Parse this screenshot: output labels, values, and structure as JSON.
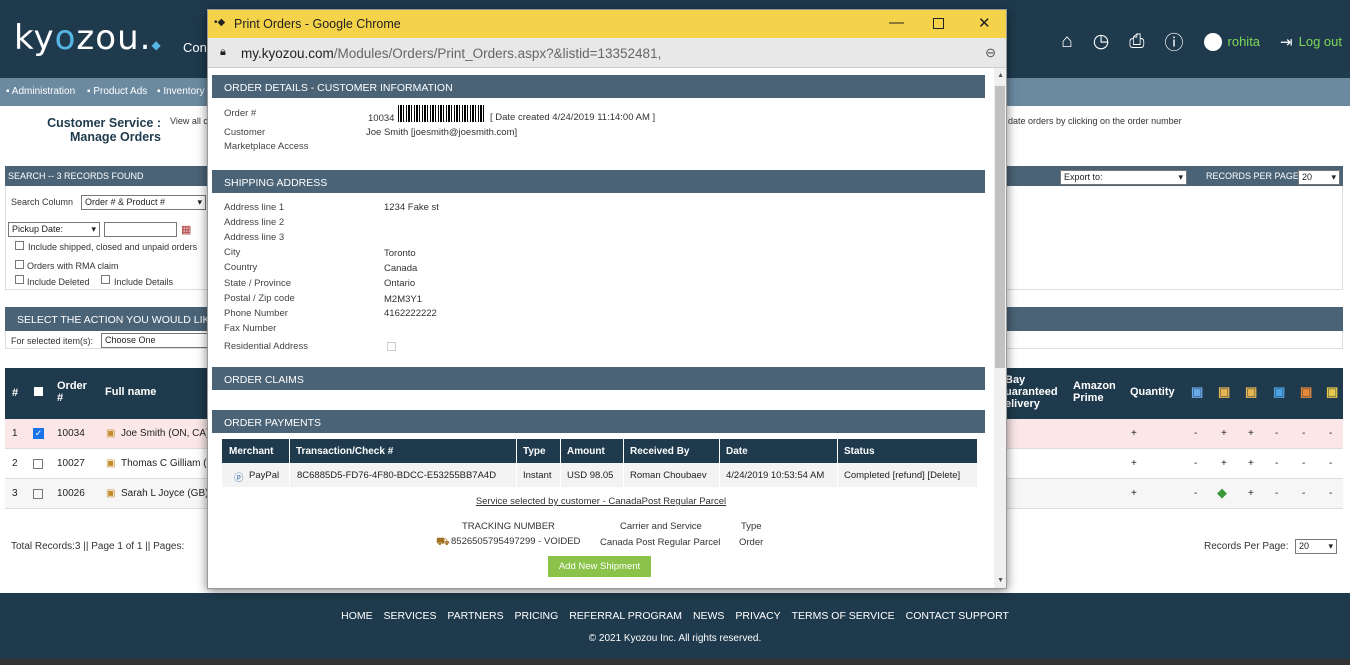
{
  "header": {
    "logo": "kyozou",
    "logo_sub": "Con",
    "user": "rohita",
    "logout": "Log out"
  },
  "nav": [
    "Administration",
    "Product Ads",
    "Inventory"
  ],
  "page": {
    "title": "Customer Service : Manage Orders",
    "desc_left": "View all c",
    "desc_right": "date orders by clicking on the order number"
  },
  "search": {
    "bar": "SEARCH -- 3 RECORDS FOUND",
    "column_label": "Search Column",
    "column_value": "Order # & Product #",
    "date_select": "Pickup Date:",
    "cb_shipped": "Include shipped, closed and unpaid orders",
    "cb_rma": "Orders with RMA claim",
    "cb_deleted": "Include Deleted",
    "cb_details": "Include Details",
    "export_value": "Export to:",
    "records_label": "RECORDS PER PAGE:",
    "records_value": "20"
  },
  "action": {
    "bar": "SELECT THE ACTION YOU WOULD LIKE",
    "label": "For selected item(s):",
    "value": "Choose One"
  },
  "grid": {
    "headers": {
      "num": "#",
      "order": "Order #",
      "fullname": "Full name",
      "ebay": "Bay uaranteed elivery",
      "prime": "Amazon Prime",
      "qty": "Quantity"
    },
    "rows": [
      {
        "n": "1",
        "order": "10034",
        "name": "Joe Smith (ON, CA)",
        "checked": true,
        "qty": "+",
        "cells": [
          "-",
          "+",
          "+",
          "-",
          "-",
          "-"
        ]
      },
      {
        "n": "2",
        "order": "10027",
        "name": "Thomas C Gilliam (C",
        "checked": false,
        "qty": "+",
        "cells": [
          "-",
          "+",
          "+",
          "-",
          "-",
          "-"
        ]
      },
      {
        "n": "3",
        "order": "10026",
        "name": "Sarah L Joyce (GB)",
        "checked": false,
        "qty": "+",
        "cells": [
          "-",
          "",
          "+",
          "-",
          "-",
          "-"
        ]
      }
    ]
  },
  "totals": {
    "left": "Total Records:3 || Page 1 of 1 || Pages:",
    "right_label": "Records Per Page:",
    "right_value": "20"
  },
  "footer": {
    "links": [
      "HOME",
      "SERVICES",
      "PARTNERS",
      "PRICING",
      "REFERRAL PROGRAM",
      "NEWS",
      "PRIVACY",
      "TERMS OF SERVICE",
      "CONTACT SUPPORT"
    ],
    "copyright": "© 2021 Kyozou Inc. All rights reserved."
  },
  "popup": {
    "title": "Print Orders - Google Chrome",
    "url_host": "my.kyozou.com",
    "url_path": "/Modules/Orders/Print_Orders.aspx?&listid=13352481,",
    "order_details": {
      "heading": "ORDER DETAILS - CUSTOMER INFORMATION",
      "order_label": "Order #",
      "order_value": "10034",
      "date_created": "[ Date created  4/24/2019 11:14:00 AM ]",
      "customer_label": "Customer",
      "customer_value": "Joe Smith [joesmith@joesmith.com]",
      "marketplace_label": "Marketplace Access"
    },
    "shipping": {
      "heading": "SHIPPING ADDRESS",
      "fields": [
        {
          "label": "Address line 1",
          "value": "1234 Fake st"
        },
        {
          "label": "Address line 2",
          "value": ""
        },
        {
          "label": "Address line 3",
          "value": ""
        },
        {
          "label": "City",
          "value": "Toronto"
        },
        {
          "label": "Country",
          "value": "Canada"
        },
        {
          "label": "State / Province",
          "value": "Ontario"
        },
        {
          "label": "Postal / Zip code",
          "value": "M2M3Y1"
        },
        {
          "label": "Phone Number",
          "value": "4162222222"
        },
        {
          "label": "Fax Number",
          "value": ""
        }
      ],
      "residential_label": "Residential Address"
    },
    "claims_heading": "ORDER CLAIMS",
    "payments": {
      "heading": "ORDER PAYMENTS",
      "cols": [
        "Merchant",
        "Transaction/Check #",
        "Type",
        "Amount",
        "Received By",
        "Date",
        "Status"
      ],
      "row": {
        "merchant": "PayPal",
        "transaction": "8C6885D5-FD76-4F80-BDCC-E53255BB7A4D",
        "type": "Instant",
        "amount": "USD 98.05",
        "received_by": "Roman Choubaev",
        "date": "4/24/2019 10:53:54 AM",
        "status": "Completed [refund] [Delete]"
      }
    },
    "service_text": "Service selected by customer - CanadaPost Regular Parcel",
    "tracking": {
      "h_number": "TRACKING NUMBER",
      "h_carrier": "Carrier and Service",
      "h_type": "Type",
      "number": "8526505795497299 - VOIDED",
      "carrier": "Canada Post Regular Parcel",
      "type": "Order"
    },
    "add_button": "Add New Shipment"
  }
}
